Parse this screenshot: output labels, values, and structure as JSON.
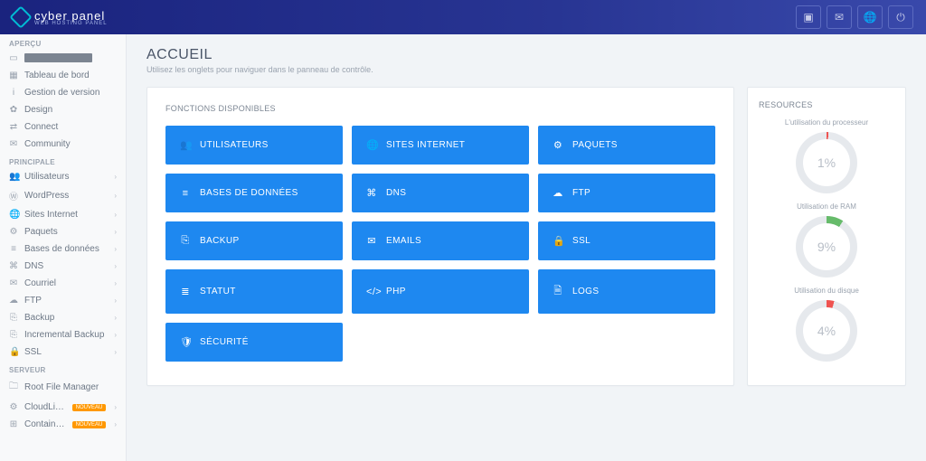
{
  "brand": {
    "title": "cyber panel",
    "subtitle": "WEB HOSTING PANEL"
  },
  "topbar_icons": [
    "youtube-icon",
    "chat-icon",
    "globe-icon",
    "power-icon"
  ],
  "sidebar": {
    "sections": [
      {
        "title": "APERÇU",
        "items": [
          {
            "icon": "▭",
            "masked": true,
            "label": "",
            "name": "sidebar-item-dashboard-masked"
          },
          {
            "icon": "▦",
            "label": "Tableau de bord",
            "name": "sidebar-item-tableau"
          },
          {
            "icon": "i",
            "label": "Gestion de version",
            "name": "sidebar-item-version"
          },
          {
            "icon": "✿",
            "label": "Design",
            "name": "sidebar-item-design"
          },
          {
            "icon": "⇄",
            "label": "Connect",
            "name": "sidebar-item-connect"
          },
          {
            "icon": "✉",
            "label": "Community",
            "name": "sidebar-item-community"
          }
        ]
      },
      {
        "title": "PRINCIPALE",
        "items": [
          {
            "icon": "👥",
            "label": "Utilisateurs",
            "chev": true,
            "name": "sidebar-item-utilisateurs"
          },
          {
            "icon": "Ⓦ",
            "label": "WordPress",
            "chev": true,
            "name": "sidebar-item-wordpress"
          },
          {
            "icon": "🌐",
            "label": "Sites Internet",
            "chev": true,
            "name": "sidebar-item-sites"
          },
          {
            "icon": "⚙",
            "label": "Paquets",
            "chev": true,
            "name": "sidebar-item-paquets"
          },
          {
            "icon": "≡",
            "label": "Bases de données",
            "chev": true,
            "name": "sidebar-item-db"
          },
          {
            "icon": "⌘",
            "label": "DNS",
            "chev": true,
            "name": "sidebar-item-dns"
          },
          {
            "icon": "✉",
            "label": "Courriel",
            "chev": true,
            "name": "sidebar-item-courriel"
          },
          {
            "icon": "☁",
            "label": "FTP",
            "chev": true,
            "name": "sidebar-item-ftp"
          },
          {
            "icon": "⎘",
            "label": "Backup",
            "chev": true,
            "name": "sidebar-item-backup"
          },
          {
            "icon": "⎘",
            "label": "Incremental Backup",
            "chev": true,
            "name": "sidebar-item-incremental"
          },
          {
            "icon": "🔒",
            "label": "SSL",
            "chev": true,
            "name": "sidebar-item-ssl"
          }
        ]
      },
      {
        "title": "SERVEUR",
        "items": [
          {
            "icon": "🗀",
            "label": "Root File Manager",
            "name": "sidebar-item-root-file"
          },
          {
            "icon": "⚙",
            "label": "CloudLinux",
            "badge": "NOUVEAU",
            "chev": true,
            "name": "sidebar-item-cloudlinux"
          },
          {
            "icon": "⊞",
            "label": "Containerization",
            "badge": "NOUVEAU",
            "chev": true,
            "name": "sidebar-item-container"
          }
        ]
      }
    ]
  },
  "page": {
    "title": "ACCUEIL",
    "subtitle": "Utilisez les onglets pour naviguer dans le panneau de contrôle."
  },
  "functions": {
    "heading": "FONCTIONS DISPONIBLES",
    "tiles": [
      {
        "icon": "👥",
        "label": "UTILISATEURS",
        "name": "tile-utilisateurs"
      },
      {
        "icon": "🌐",
        "label": "SITES INTERNET",
        "name": "tile-sites"
      },
      {
        "icon": "⚙",
        "label": "PAQUETS",
        "name": "tile-paquets"
      },
      {
        "icon": "≡",
        "label": "BASES DE DONNÉES",
        "name": "tile-db"
      },
      {
        "icon": "⌘",
        "label": "DNS",
        "name": "tile-dns"
      },
      {
        "icon": "☁",
        "label": "FTP",
        "name": "tile-ftp"
      },
      {
        "icon": "⎘",
        "label": "BACKUP",
        "name": "tile-backup"
      },
      {
        "icon": "✉",
        "label": "EMAILS",
        "name": "tile-emails"
      },
      {
        "icon": "🔒",
        "label": "SSL",
        "name": "tile-ssl"
      },
      {
        "icon": "≣",
        "label": "STATUT",
        "name": "tile-statut"
      },
      {
        "icon": "</>",
        "label": "PHP",
        "name": "tile-php"
      },
      {
        "icon": "🗎",
        "label": "LOGS",
        "name": "tile-logs"
      },
      {
        "icon": "🛡",
        "label": "SÉCURITÉ",
        "name": "tile-securite"
      }
    ]
  },
  "resources": {
    "heading": "RESOURCES",
    "gauges": [
      {
        "label": "L'utilisation du processeur",
        "value": 1,
        "display": "1%",
        "color": "#ef5350"
      },
      {
        "label": "Utilisation de RAM",
        "value": 9,
        "display": "9%",
        "color": "#66bb6a"
      },
      {
        "label": "Utilisation du disque",
        "value": 4,
        "display": "4%",
        "color": "#ef5350"
      }
    ]
  }
}
